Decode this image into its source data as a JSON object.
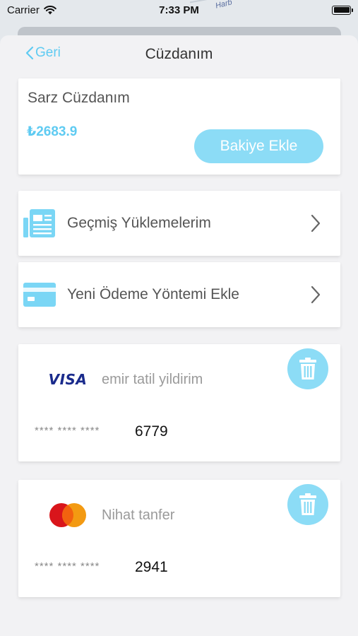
{
  "status_bar": {
    "carrier": "Carrier",
    "time": "7:33 PM",
    "icons": [
      "wifi-icon",
      "battery-icon"
    ]
  },
  "map": {
    "label": "Harb"
  },
  "nav": {
    "back_label": "Geri",
    "title": "Cüzdanım"
  },
  "wallet": {
    "name": "Sarz Cüzdanım",
    "balance": "₺2683.9",
    "add_button_label": "Bakiye Ekle"
  },
  "menu": {
    "items": [
      {
        "label": "Geçmiş Yüklemelerim",
        "icon": "history-document-icon"
      },
      {
        "label": "Yeni Ödeme Yöntemi Ekle",
        "icon": "credit-card-icon"
      }
    ]
  },
  "cards": [
    {
      "brand": "VISA",
      "brand_icon": "visa-logo",
      "holder": "emir tatil yildirim",
      "masked": "**** **** ****",
      "last4": "6779"
    },
    {
      "brand": "Mastercard",
      "brand_icon": "mastercard-logo",
      "holder": "Nihat tanfer",
      "masked": "**** **** ****",
      "last4": "2941"
    }
  ],
  "colors": {
    "accent": "#5fcbf2",
    "button_bg": "#8cdcf6",
    "background": "#f2f2f4",
    "text": "#555555"
  }
}
